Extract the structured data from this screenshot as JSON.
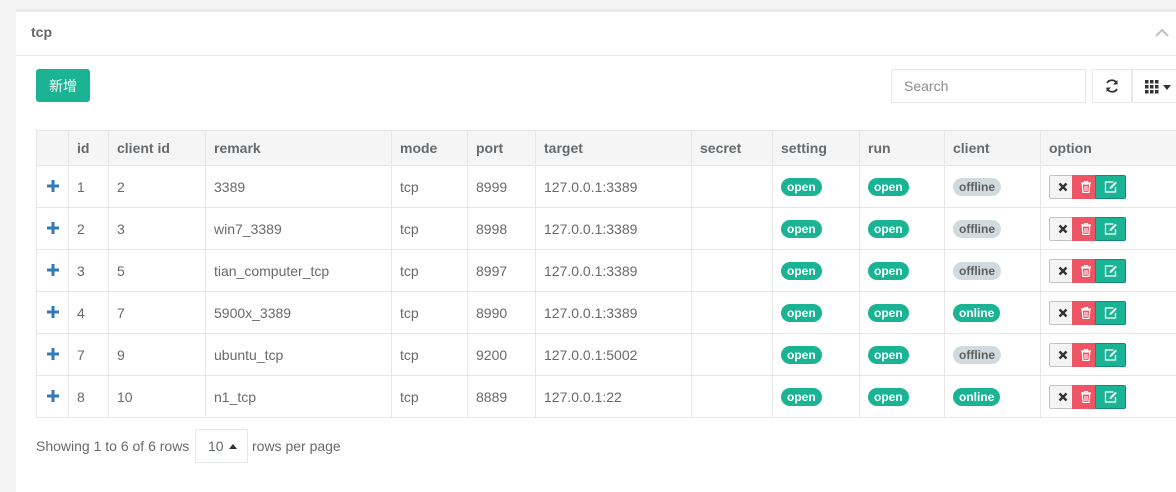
{
  "panel": {
    "title": "tcp"
  },
  "toolbar": {
    "add_label": "新增",
    "search_placeholder": "Search"
  },
  "table": {
    "headers": [
      "id",
      "client id",
      "remark",
      "mode",
      "port",
      "target",
      "secret",
      "setting",
      "run",
      "client",
      "option"
    ],
    "rows": [
      {
        "id": "1",
        "client_id": "2",
        "remark": "3389",
        "mode": "tcp",
        "port": "8999",
        "target": "127.0.0.1:3389",
        "secret": "",
        "setting": "open",
        "run": "open",
        "client": "offline"
      },
      {
        "id": "2",
        "client_id": "3",
        "remark": "win7_3389",
        "mode": "tcp",
        "port": "8998",
        "target": "127.0.0.1:3389",
        "secret": "",
        "setting": "open",
        "run": "open",
        "client": "offline"
      },
      {
        "id": "3",
        "client_id": "5",
        "remark": "tian_computer_tcp",
        "mode": "tcp",
        "port": "8997",
        "target": "127.0.0.1:3389",
        "secret": "",
        "setting": "open",
        "run": "open",
        "client": "offline"
      },
      {
        "id": "4",
        "client_id": "7",
        "remark": "5900x_3389",
        "mode": "tcp",
        "port": "8990",
        "target": "127.0.0.1:3389",
        "secret": "",
        "setting": "open",
        "run": "open",
        "client": "online"
      },
      {
        "id": "7",
        "client_id": "9",
        "remark": "ubuntu_tcp",
        "mode": "tcp",
        "port": "9200",
        "target": "127.0.0.1:5002",
        "secret": "",
        "setting": "open",
        "run": "open",
        "client": "offline"
      },
      {
        "id": "8",
        "client_id": "10",
        "remark": "n1_tcp",
        "mode": "tcp",
        "port": "8889",
        "target": "127.0.0.1:22",
        "secret": "",
        "setting": "open",
        "run": "open",
        "client": "online"
      }
    ]
  },
  "footer": {
    "showing": "Showing 1 to 6 of 6 rows",
    "page_size": "10",
    "per_page": "rows per page"
  },
  "colors": {
    "primary": "#1ab394",
    "danger": "#ed5565",
    "offline": "#d1dade",
    "plus": "#337ab7"
  },
  "icons": [
    "chevron-up-icon",
    "refresh-icon",
    "grid-icon",
    "caret-down-icon",
    "plus-icon",
    "close-icon",
    "trash-icon",
    "edit-icon",
    "caret-up-icon"
  ]
}
